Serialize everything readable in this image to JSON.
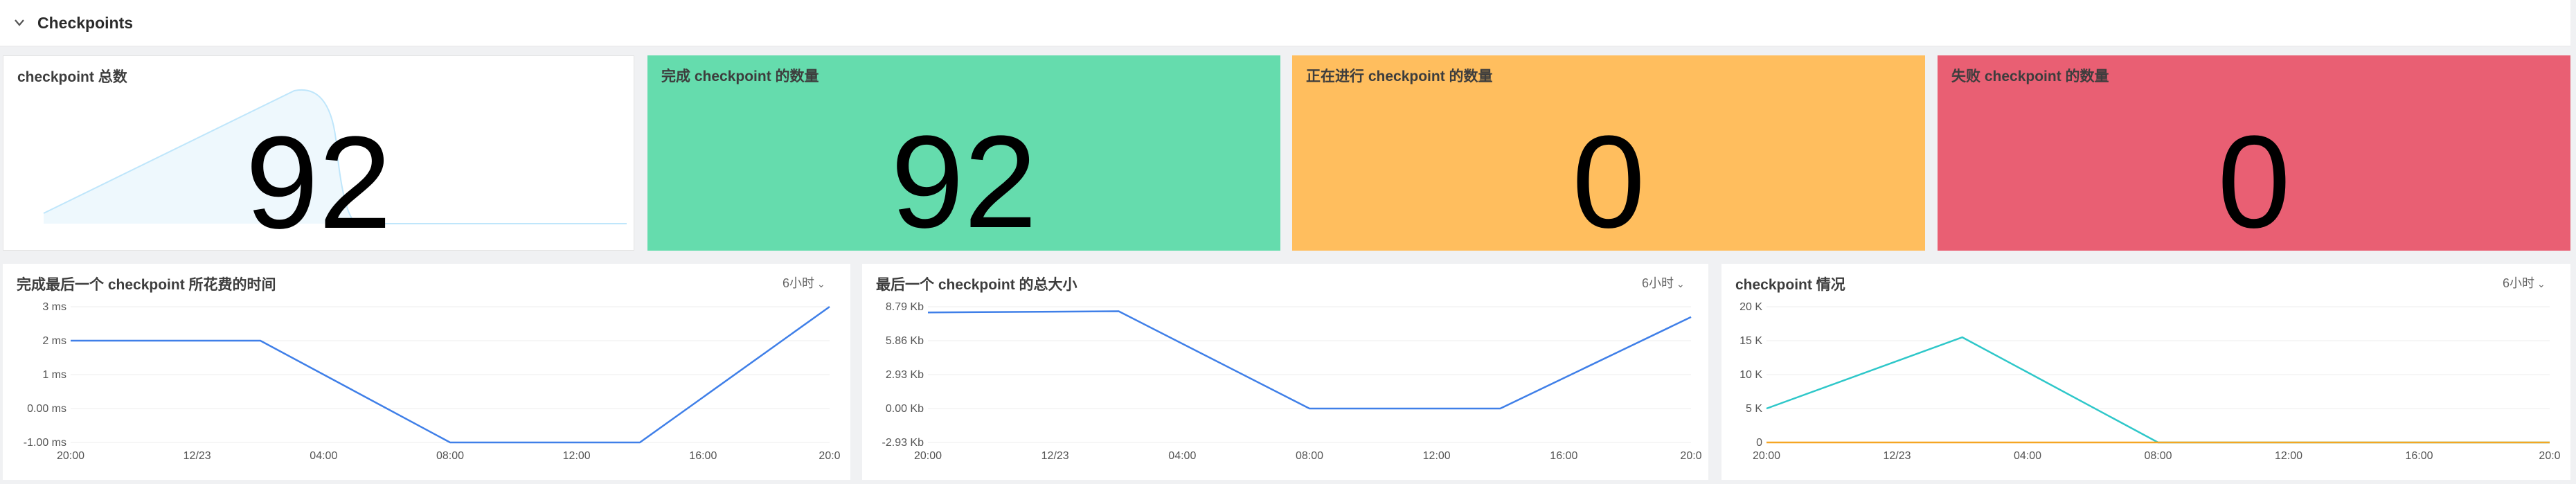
{
  "section": {
    "title": "Checkpoints",
    "collapse_icon": "chevron-down-icon"
  },
  "stats": [
    {
      "title": "checkpoint 总数",
      "value": "92",
      "color": "#ffffff"
    },
    {
      "title": "完成 checkpoint 的数量",
      "value": "92",
      "color": "#65dcad"
    },
    {
      "title": "正在进行 checkpoint 的数量",
      "value": "0",
      "color": "#ffbe5e"
    },
    {
      "title": "失败 checkpoint 的数量",
      "value": "0",
      "color": "#e95f73"
    }
  ],
  "charts": [
    {
      "title": "完成最后一个 checkpoint 所花费的时间",
      "range": "6小时"
    },
    {
      "title": "最后一个 checkpoint 的总大小",
      "range": "6小时"
    },
    {
      "title": "checkpoint 情况",
      "range": "6小时"
    }
  ],
  "chart_data": [
    {
      "type": "line",
      "title": "完成最后一个 checkpoint 所花费的时间",
      "x": [
        "20:00",
        "12/23",
        "04:00",
        "08:00",
        "12:00",
        "16:00",
        "20:0"
      ],
      "y_ticks": [
        "3 ms",
        "2 ms",
        "1 ms",
        "0.00 ms",
        "-1.00 ms"
      ],
      "ylim": [
        -1,
        3
      ],
      "series": [
        {
          "color": "#3f7fe8",
          "points": [
            [
              0,
              2
            ],
            [
              1.5,
              2
            ],
            [
              3,
              -1
            ],
            [
              4.5,
              -1
            ],
            [
              6,
              3
            ]
          ]
        }
      ]
    },
    {
      "type": "line",
      "title": "最后一个 checkpoint 的总大小",
      "x": [
        "20:00",
        "12/23",
        "04:00",
        "08:00",
        "12:00",
        "16:00",
        "20:0"
      ],
      "y_ticks": [
        "8.79 Kb",
        "5.86 Kb",
        "2.93 Kb",
        "0.00 Kb",
        "-2.93 Kb"
      ],
      "ylim": [
        -2.93,
        8.79
      ],
      "series": [
        {
          "color": "#3f7fe8",
          "points": [
            [
              0,
              8.3
            ],
            [
              1.5,
              8.4
            ],
            [
              3,
              0
            ],
            [
              4.5,
              0
            ],
            [
              6,
              7.9
            ]
          ]
        }
      ]
    },
    {
      "type": "line",
      "title": "checkpoint 情况",
      "x": [
        "20:00",
        "12/23",
        "04:00",
        "08:00",
        "12:00",
        "16:00",
        "20:0"
      ],
      "y_ticks": [
        "20 K",
        "15 K",
        "10 K",
        "5 K",
        "0"
      ],
      "ylim": [
        0,
        20000
      ],
      "series": [
        {
          "color": "#2ec7c9",
          "points": [
            [
              0,
              5000
            ],
            [
              1.5,
              15500
            ],
            [
              3,
              0
            ],
            [
              6,
              0
            ]
          ]
        },
        {
          "color": "#f5a623",
          "points": [
            [
              0,
              0
            ],
            [
              6,
              0
            ]
          ]
        }
      ]
    }
  ]
}
